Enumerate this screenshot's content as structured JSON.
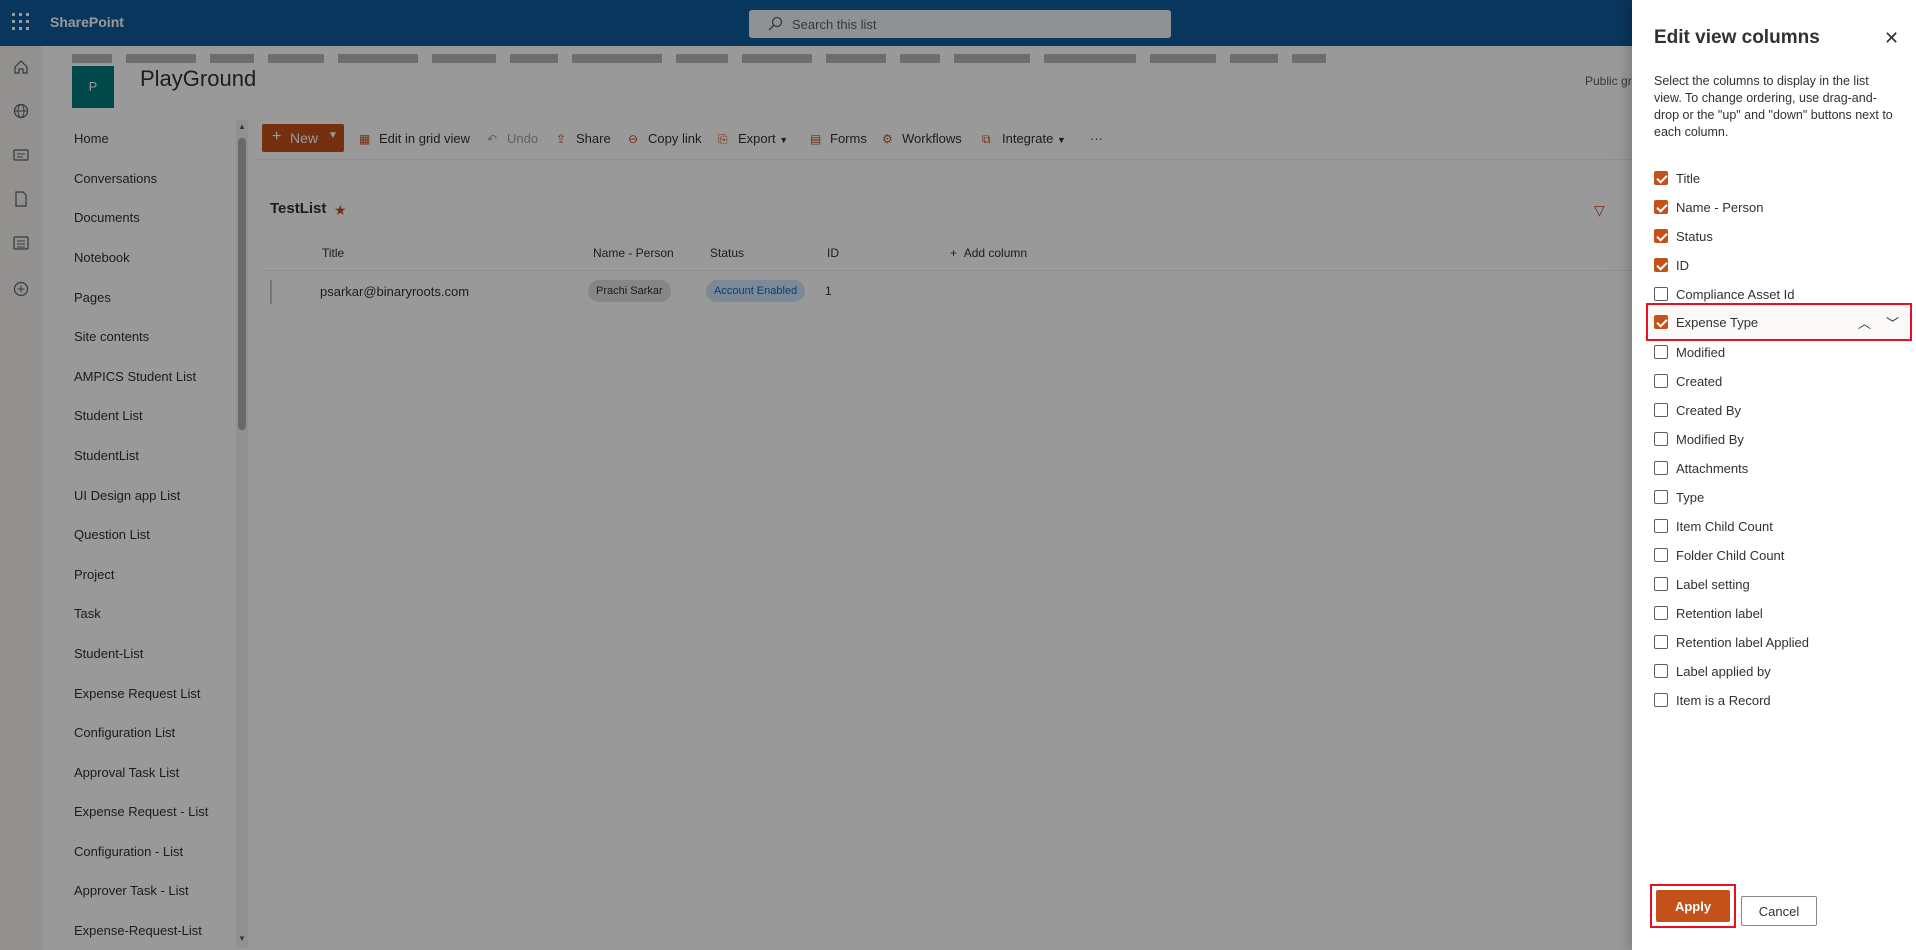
{
  "suite": {
    "brand": "SharePoint",
    "search_placeholder": "Search this list"
  },
  "site": {
    "logo_letter": "P",
    "title": "PlayGround",
    "visibility": "Public gr"
  },
  "nav": {
    "items": [
      {
        "label": "Home"
      },
      {
        "label": "Conversations"
      },
      {
        "label": "Documents"
      },
      {
        "label": "Notebook"
      },
      {
        "label": "Pages"
      },
      {
        "label": "Site contents"
      },
      {
        "label": "AMPICS Student List"
      },
      {
        "label": "Student List"
      },
      {
        "label": "StudentList"
      },
      {
        "label": "UI Design app List"
      },
      {
        "label": "Question List"
      },
      {
        "label": "Project"
      },
      {
        "label": "Task"
      },
      {
        "label": "Student-List"
      },
      {
        "label": "Expense Request List"
      },
      {
        "label": "Configuration List"
      },
      {
        "label": "Approval Task List"
      },
      {
        "label": "Expense Request - List"
      },
      {
        "label": "Configuration - List"
      },
      {
        "label": "Approver Task - List"
      },
      {
        "label": "Expense-Request-List"
      }
    ]
  },
  "toolbar": {
    "new_label": "New",
    "grid_label": "Edit in grid view",
    "undo_label": "Undo",
    "share_label": "Share",
    "copy_label": "Copy link",
    "export_label": "Export",
    "forms_label": "Forms",
    "workflows_label": "Workflows",
    "integrate_label": "Integrate",
    "more_label": "···"
  },
  "list": {
    "name": "TestList",
    "columns": {
      "title": "Title",
      "person": "Name - Person",
      "status": "Status",
      "id": "ID",
      "add": "Add column"
    },
    "rows": [
      {
        "title": "psarkar@binaryroots.com",
        "person": "Prachi Sarkar",
        "status": "Account Enabled",
        "id": "1"
      }
    ]
  },
  "panel": {
    "title": "Edit view columns",
    "description": "Select the columns to display in the list view. To change ordering, use drag-and-drop or the \"up\" and \"down\" buttons next to each column.",
    "options": [
      {
        "label": "Title",
        "checked": true
      },
      {
        "label": "Name - Person",
        "checked": true
      },
      {
        "label": "Status",
        "checked": true
      },
      {
        "label": "ID",
        "checked": true
      },
      {
        "label": "Compliance Asset Id",
        "checked": false
      },
      {
        "label": "Expense Type",
        "checked": true
      },
      {
        "label": "Modified",
        "checked": false
      },
      {
        "label": "Created",
        "checked": false
      },
      {
        "label": "Created By",
        "checked": false
      },
      {
        "label": "Modified By",
        "checked": false
      },
      {
        "label": "Attachments",
        "checked": false
      },
      {
        "label": "Type",
        "checked": false
      },
      {
        "label": "Item Child Count",
        "checked": false
      },
      {
        "label": "Folder Child Count",
        "checked": false
      },
      {
        "label": "Label setting",
        "checked": false
      },
      {
        "label": "Retention label",
        "checked": false
      },
      {
        "label": "Retention label Applied",
        "checked": false
      },
      {
        "label": "Label applied by",
        "checked": false
      },
      {
        "label": "Item is a Record",
        "checked": false
      }
    ],
    "apply_label": "Apply",
    "cancel_label": "Cancel"
  },
  "colors": {
    "suite": "#0f5a99",
    "accent": "#c4501a",
    "highlight": "#e81123"
  }
}
